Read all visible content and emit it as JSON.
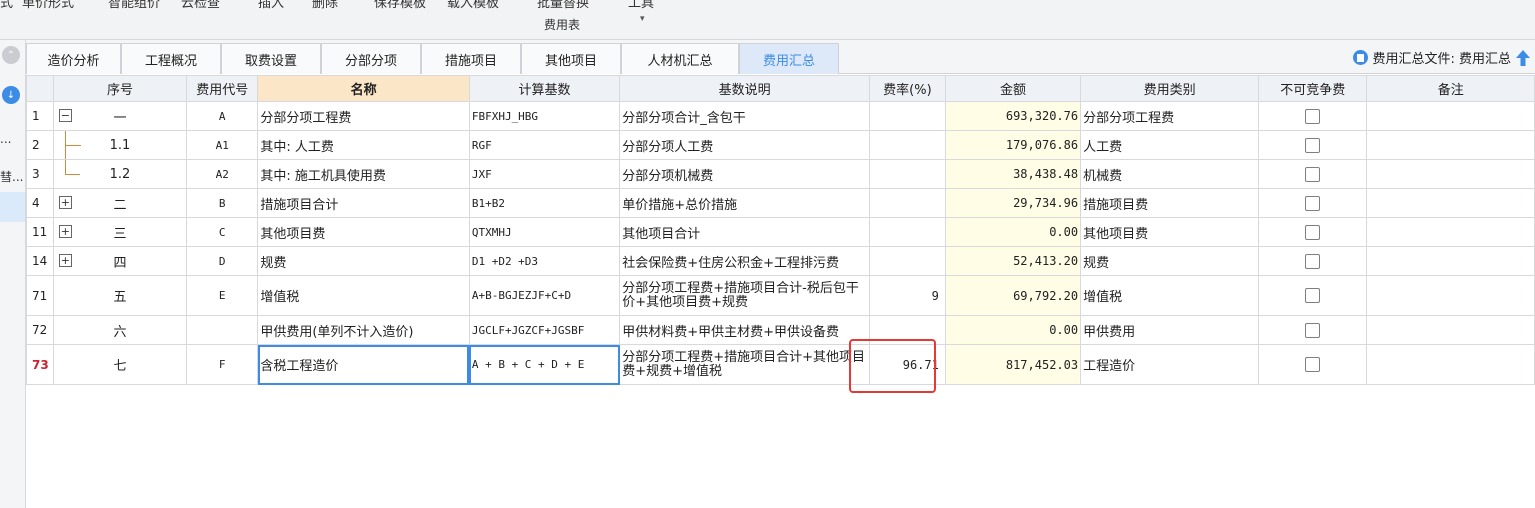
{
  "toolbar": {
    "items": [
      "式",
      "单价形式",
      "智能组价",
      "云检查",
      "插入",
      "删除",
      "保存模板",
      "载入模板",
      "批量替换",
      "工具"
    ],
    "batch_sub": "费用表"
  },
  "left_strip": {
    "items": [
      "...",
      "彗..."
    ]
  },
  "tabs": [
    "造价分析",
    "工程概况",
    "取费设置",
    "分部分项",
    "措施项目",
    "其他项目",
    "人材机汇总",
    "费用汇总"
  ],
  "summary_file": "费用汇总文件: 费用汇总",
  "columns": [
    "序号",
    "费用代号",
    "名称",
    "计算基数",
    "基数说明",
    "费率(%)",
    "金额",
    "费用类别",
    "不可竞争费",
    "备注"
  ],
  "rows": [
    {
      "rn": "1",
      "seq": "一",
      "code": "A",
      "name": "分部分项工程费",
      "base": "FBFXHJ_HBG",
      "desc": "分部分项合计_含包干",
      "rate": "",
      "amount": "693,320.76",
      "category": "分部分项工程费"
    },
    {
      "rn": "2",
      "seq": "1.1",
      "code": "A1",
      "name": "其中: 人工费",
      "base": "RGF",
      "desc": "分部分项人工费",
      "rate": "",
      "amount": "179,076.86",
      "category": "人工费"
    },
    {
      "rn": "3",
      "seq": "1.2",
      "code": "A2",
      "name": "其中: 施工机具使用费",
      "base": "JXF",
      "desc": "分部分项机械费",
      "rate": "",
      "amount": "38,438.48",
      "category": "机械费"
    },
    {
      "rn": "4",
      "seq": "二",
      "code": "B",
      "name": "措施项目合计",
      "base": "B1+B2",
      "desc": "单价措施+总价措施",
      "rate": "",
      "amount": "29,734.96",
      "category": "措施项目费"
    },
    {
      "rn": "11",
      "seq": "三",
      "code": "C",
      "name": "其他项目费",
      "base": "QTXMHJ",
      "desc": "其他项目合计",
      "rate": "",
      "amount": "0.00",
      "category": "其他项目费"
    },
    {
      "rn": "14",
      "seq": "四",
      "code": "D",
      "name": "规费",
      "base": "D1 +D2 +D3",
      "desc": "社会保险费+住房公积金+工程排污费",
      "rate": "",
      "amount": "52,413.20",
      "category": "规费"
    },
    {
      "rn": "71",
      "seq": "五",
      "code": "E",
      "name": "增值税",
      "base": "A+B-BGJEZJF+C+D",
      "desc": "分部分项工程费+措施项目合计-税后包干价+其他项目费+规费",
      "rate": "9",
      "amount": "69,792.20",
      "category": "增值税"
    },
    {
      "rn": "72",
      "seq": "六",
      "code": "",
      "name": "甲供费用(单列不计入造价)",
      "base": "JGCLF+JGZCF+JGSBF",
      "desc": "甲供材料费+甲供主材费+甲供设备费",
      "rate": "",
      "amount": "0.00",
      "category": "甲供费用"
    },
    {
      "rn": "73",
      "seq": "七",
      "code": "F",
      "name": "含税工程造价",
      "base": "A + B + C + D + E",
      "desc": "分部分项工程费+措施项目合计+其他项目费+规费+增值税",
      "rate": "96.71",
      "amount": "817,452.03",
      "category": "工程造价"
    }
  ],
  "colors": {
    "accent": "#3c8ce7",
    "highlight_box": "#e53935",
    "amount_bg": "#fffde6",
    "name_header_bg": "#fbe6c8"
  }
}
